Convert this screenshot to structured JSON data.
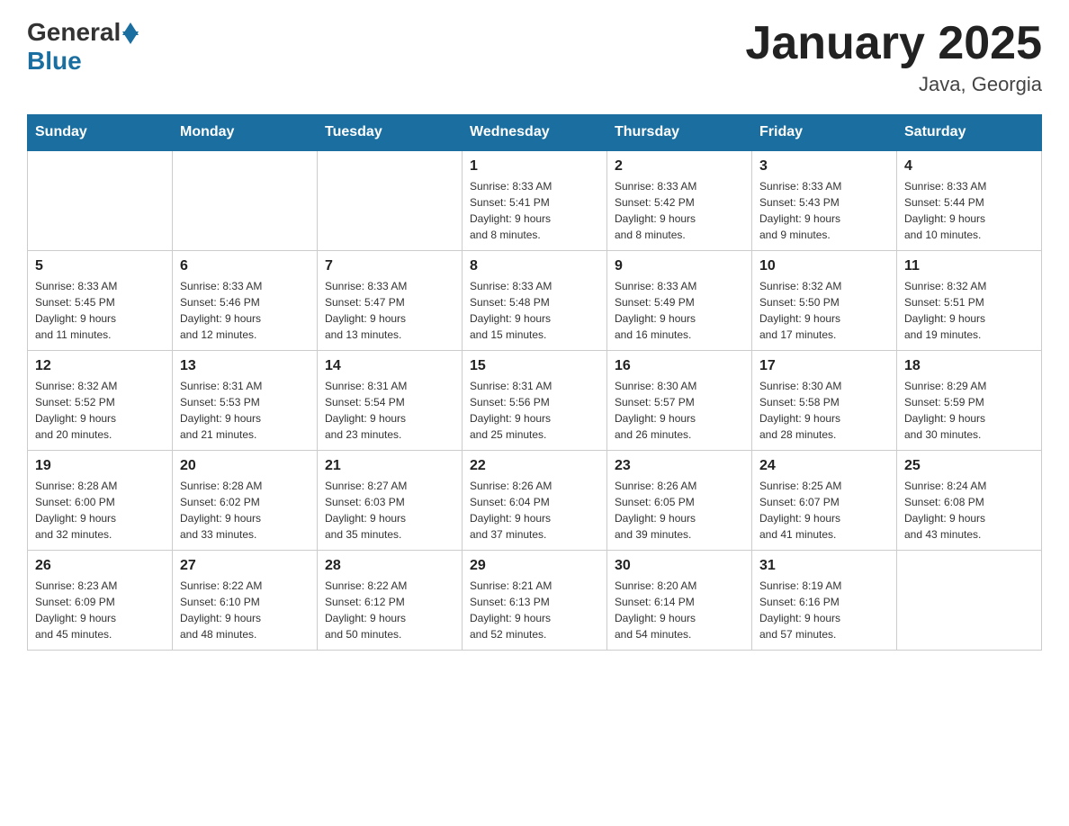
{
  "logo": {
    "general": "General",
    "blue": "Blue"
  },
  "title": "January 2025",
  "subtitle": "Java, Georgia",
  "days_of_week": [
    "Sunday",
    "Monday",
    "Tuesday",
    "Wednesday",
    "Thursday",
    "Friday",
    "Saturday"
  ],
  "weeks": [
    [
      {
        "day": "",
        "info": ""
      },
      {
        "day": "",
        "info": ""
      },
      {
        "day": "",
        "info": ""
      },
      {
        "day": "1",
        "info": "Sunrise: 8:33 AM\nSunset: 5:41 PM\nDaylight: 9 hours\nand 8 minutes."
      },
      {
        "day": "2",
        "info": "Sunrise: 8:33 AM\nSunset: 5:42 PM\nDaylight: 9 hours\nand 8 minutes."
      },
      {
        "day": "3",
        "info": "Sunrise: 8:33 AM\nSunset: 5:43 PM\nDaylight: 9 hours\nand 9 minutes."
      },
      {
        "day": "4",
        "info": "Sunrise: 8:33 AM\nSunset: 5:44 PM\nDaylight: 9 hours\nand 10 minutes."
      }
    ],
    [
      {
        "day": "5",
        "info": "Sunrise: 8:33 AM\nSunset: 5:45 PM\nDaylight: 9 hours\nand 11 minutes."
      },
      {
        "day": "6",
        "info": "Sunrise: 8:33 AM\nSunset: 5:46 PM\nDaylight: 9 hours\nand 12 minutes."
      },
      {
        "day": "7",
        "info": "Sunrise: 8:33 AM\nSunset: 5:47 PM\nDaylight: 9 hours\nand 13 minutes."
      },
      {
        "day": "8",
        "info": "Sunrise: 8:33 AM\nSunset: 5:48 PM\nDaylight: 9 hours\nand 15 minutes."
      },
      {
        "day": "9",
        "info": "Sunrise: 8:33 AM\nSunset: 5:49 PM\nDaylight: 9 hours\nand 16 minutes."
      },
      {
        "day": "10",
        "info": "Sunrise: 8:32 AM\nSunset: 5:50 PM\nDaylight: 9 hours\nand 17 minutes."
      },
      {
        "day": "11",
        "info": "Sunrise: 8:32 AM\nSunset: 5:51 PM\nDaylight: 9 hours\nand 19 minutes."
      }
    ],
    [
      {
        "day": "12",
        "info": "Sunrise: 8:32 AM\nSunset: 5:52 PM\nDaylight: 9 hours\nand 20 minutes."
      },
      {
        "day": "13",
        "info": "Sunrise: 8:31 AM\nSunset: 5:53 PM\nDaylight: 9 hours\nand 21 minutes."
      },
      {
        "day": "14",
        "info": "Sunrise: 8:31 AM\nSunset: 5:54 PM\nDaylight: 9 hours\nand 23 minutes."
      },
      {
        "day": "15",
        "info": "Sunrise: 8:31 AM\nSunset: 5:56 PM\nDaylight: 9 hours\nand 25 minutes."
      },
      {
        "day": "16",
        "info": "Sunrise: 8:30 AM\nSunset: 5:57 PM\nDaylight: 9 hours\nand 26 minutes."
      },
      {
        "day": "17",
        "info": "Sunrise: 8:30 AM\nSunset: 5:58 PM\nDaylight: 9 hours\nand 28 minutes."
      },
      {
        "day": "18",
        "info": "Sunrise: 8:29 AM\nSunset: 5:59 PM\nDaylight: 9 hours\nand 30 minutes."
      }
    ],
    [
      {
        "day": "19",
        "info": "Sunrise: 8:28 AM\nSunset: 6:00 PM\nDaylight: 9 hours\nand 32 minutes."
      },
      {
        "day": "20",
        "info": "Sunrise: 8:28 AM\nSunset: 6:02 PM\nDaylight: 9 hours\nand 33 minutes."
      },
      {
        "day": "21",
        "info": "Sunrise: 8:27 AM\nSunset: 6:03 PM\nDaylight: 9 hours\nand 35 minutes."
      },
      {
        "day": "22",
        "info": "Sunrise: 8:26 AM\nSunset: 6:04 PM\nDaylight: 9 hours\nand 37 minutes."
      },
      {
        "day": "23",
        "info": "Sunrise: 8:26 AM\nSunset: 6:05 PM\nDaylight: 9 hours\nand 39 minutes."
      },
      {
        "day": "24",
        "info": "Sunrise: 8:25 AM\nSunset: 6:07 PM\nDaylight: 9 hours\nand 41 minutes."
      },
      {
        "day": "25",
        "info": "Sunrise: 8:24 AM\nSunset: 6:08 PM\nDaylight: 9 hours\nand 43 minutes."
      }
    ],
    [
      {
        "day": "26",
        "info": "Sunrise: 8:23 AM\nSunset: 6:09 PM\nDaylight: 9 hours\nand 45 minutes."
      },
      {
        "day": "27",
        "info": "Sunrise: 8:22 AM\nSunset: 6:10 PM\nDaylight: 9 hours\nand 48 minutes."
      },
      {
        "day": "28",
        "info": "Sunrise: 8:22 AM\nSunset: 6:12 PM\nDaylight: 9 hours\nand 50 minutes."
      },
      {
        "day": "29",
        "info": "Sunrise: 8:21 AM\nSunset: 6:13 PM\nDaylight: 9 hours\nand 52 minutes."
      },
      {
        "day": "30",
        "info": "Sunrise: 8:20 AM\nSunset: 6:14 PM\nDaylight: 9 hours\nand 54 minutes."
      },
      {
        "day": "31",
        "info": "Sunrise: 8:19 AM\nSunset: 6:16 PM\nDaylight: 9 hours\nand 57 minutes."
      },
      {
        "day": "",
        "info": ""
      }
    ]
  ]
}
